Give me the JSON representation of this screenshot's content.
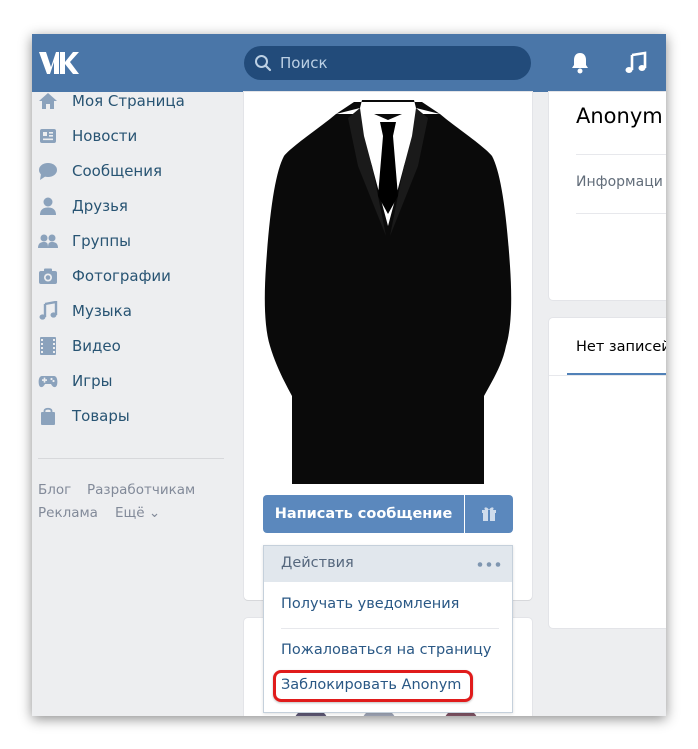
{
  "header": {
    "logo": "vk-logo",
    "search": {
      "placeholder": "Поиск",
      "icon": "search-icon"
    },
    "icons": [
      "bell-icon",
      "music-note-icon"
    ],
    "colors": {
      "bar": "#4a76a8",
      "search_bg": "#224b7a"
    }
  },
  "sidebar": {
    "items": [
      {
        "label": "Моя Страница",
        "icon": "home-icon"
      },
      {
        "label": "Новости",
        "icon": "news-icon"
      },
      {
        "label": "Сообщения",
        "icon": "messages-icon"
      },
      {
        "label": "Друзья",
        "icon": "friend-icon"
      },
      {
        "label": "Группы",
        "icon": "groups-icon"
      },
      {
        "label": "Фотографии",
        "icon": "camera-icon"
      },
      {
        "label": "Музыка",
        "icon": "music-icon"
      },
      {
        "label": "Видео",
        "icon": "video-icon"
      },
      {
        "label": "Игры",
        "icon": "gamepad-icon"
      },
      {
        "label": "Товары",
        "icon": "shopping-bag-icon"
      }
    ],
    "footer": {
      "blog": "Блог",
      "developers": "Разработчикам",
      "ads": "Реклама",
      "more": "Ещё ⌄"
    }
  },
  "profile": {
    "name": "Anonym",
    "info_link": "Информаци",
    "write_message": "Написать сообщение",
    "gift_icon": "gift-icon",
    "wall_tab": "Нет записей"
  },
  "actions_menu": {
    "title": "Действия",
    "items": [
      "Получать уведомления",
      "Пожаловаться на страницу",
      "Заблокировать Anonym"
    ],
    "highlight_color": "#e01b1b"
  }
}
